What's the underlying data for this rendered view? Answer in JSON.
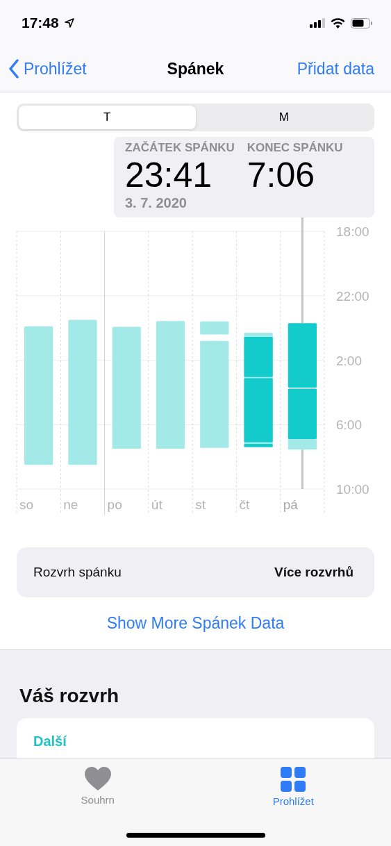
{
  "status_bar": {
    "time": "17:48"
  },
  "nav": {
    "back": "Prohlížet",
    "title": "Spánek",
    "action": "Přidat data"
  },
  "segments": [
    {
      "label": "T",
      "selected": true
    },
    {
      "label": "M",
      "selected": false
    }
  ],
  "tooltip": {
    "columns": [
      {
        "label": "ZAČÁTEK SPÁNKU",
        "value": "23:41"
      },
      {
        "label": "KONEC SPÁNKU",
        "value": "7:06"
      }
    ],
    "date": "3. 7. 2020"
  },
  "chart": {
    "y_labels": [
      "18:00",
      "22:00",
      "2:00",
      "6:00",
      "10:00"
    ],
    "days": [
      {
        "label": "so",
        "selected": false
      },
      {
        "label": "ne",
        "selected": false
      },
      {
        "label": "po",
        "selected": false
      },
      {
        "label": "út",
        "selected": false
      },
      {
        "label": "st",
        "selected": false
      },
      {
        "label": "čt",
        "selected": false
      },
      {
        "label": "pá",
        "selected": true
      }
    ]
  },
  "schedule_row": {
    "label": "Rozvrh spánku",
    "value": "Více rozvrhů"
  },
  "more_link": "Show More Spánek Data",
  "section": {
    "title": "Váš rozvrh",
    "card_label": "Další"
  },
  "tab_bar": [
    {
      "label": "Souhrn",
      "selected": false
    },
    {
      "label": "Prohlížet",
      "selected": true
    }
  ]
}
